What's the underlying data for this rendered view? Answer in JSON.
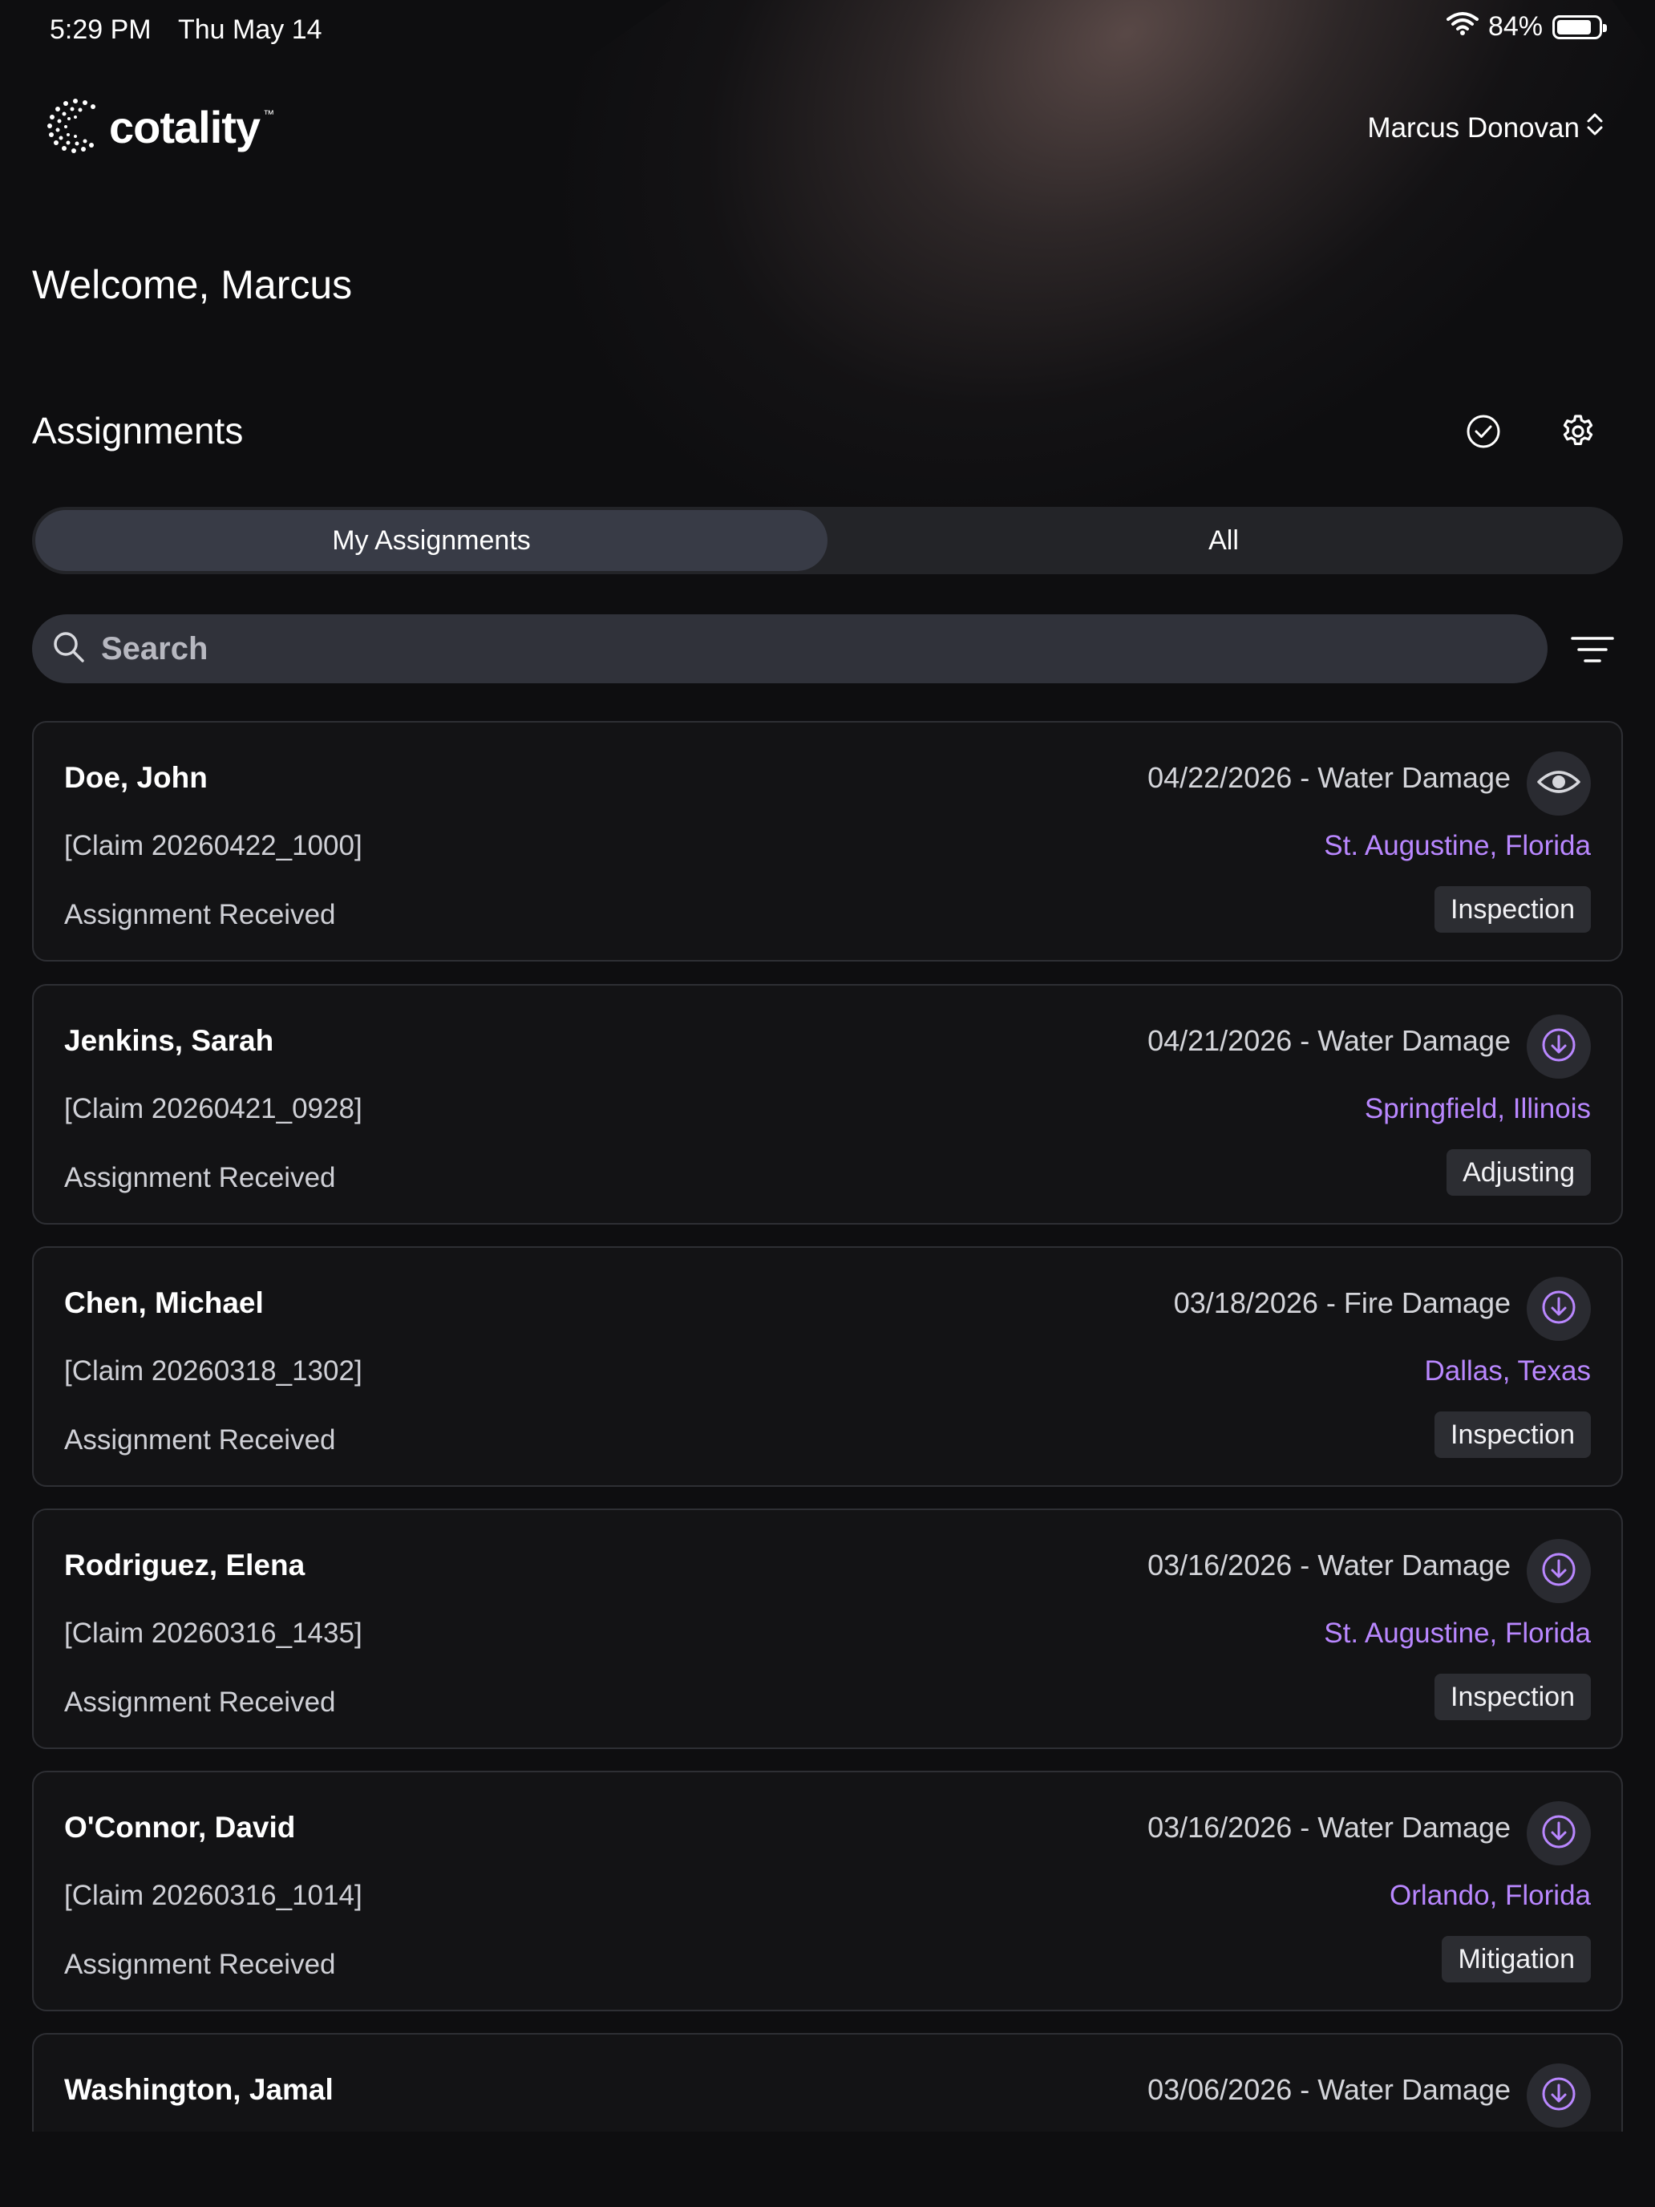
{
  "status_bar": {
    "time": "5:29 PM",
    "date": "Thu May 14",
    "battery": "84%",
    "battery_level": 0.84
  },
  "header": {
    "logo_text": "cotality",
    "logo_tm": "™",
    "user_name": "Marcus Donovan"
  },
  "welcome": "Welcome, Marcus",
  "assignments": {
    "title": "Assignments",
    "tabs": [
      "My Assignments",
      "All"
    ],
    "active_tab": 0,
    "search_placeholder": "Search",
    "items": [
      {
        "name": "Doe, John",
        "claim": "[Claim 20260422_1000]",
        "status": "Assignment Received",
        "date_type": "04/22/2026 - Water Damage",
        "location": "St. Augustine, Florida",
        "badge": "Inspection",
        "action_icon": "eye-icon"
      },
      {
        "name": "Jenkins, Sarah",
        "claim": "[Claim 20260421_0928]",
        "status": "Assignment Received",
        "date_type": "04/21/2026 - Water Damage",
        "location": "Springfield, Illinois",
        "badge": "Adjusting",
        "action_icon": "download-icon"
      },
      {
        "name": "Chen, Michael",
        "claim": "[Claim 20260318_1302]",
        "status": "Assignment Received",
        "date_type": "03/18/2026 - Fire Damage",
        "location": "Dallas, Texas",
        "badge": "Inspection",
        "action_icon": "download-icon"
      },
      {
        "name": "Rodriguez, Elena",
        "claim": "[Claim 20260316_1435]",
        "status": "Assignment Received",
        "date_type": "03/16/2026 - Water Damage",
        "location": "St. Augustine, Florida",
        "badge": "Inspection",
        "action_icon": "download-icon"
      },
      {
        "name": "O'Connor, David",
        "claim": "[Claim 20260316_1014]",
        "status": "Assignment Received",
        "date_type": "03/16/2026 - Water Damage",
        "location": "Orlando, Florida",
        "badge": "Mitigation",
        "action_icon": "download-icon"
      },
      {
        "name": "Washington, Jamal",
        "date_type": "03/06/2026 - Water Damage",
        "action_icon": "download-icon"
      }
    ]
  },
  "colors": {
    "background": "#0e0e10",
    "accent_location": "#b987ff",
    "card_border": "#2e2f34"
  }
}
